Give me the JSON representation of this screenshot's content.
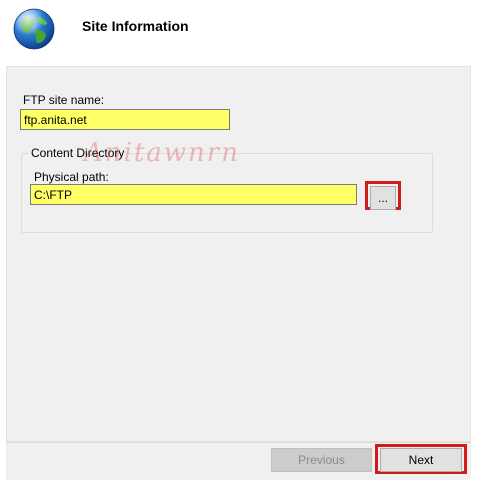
{
  "header": {
    "title": "Site Information",
    "icon": "globe-icon"
  },
  "form": {
    "site_name_label": "FTP site name:",
    "site_name_value": "ftp.anita.net",
    "content_directory_legend": "Content Directory",
    "physical_path_label": "Physical path:",
    "physical_path_value": "C:\\FTP",
    "browse_label": "..."
  },
  "watermark": "Anitawnrn",
  "footer": {
    "previous_label": "Previous",
    "next_label": "Next"
  },
  "colors": {
    "input_highlight": "#ffff66",
    "annotation_red": "#d11a1a"
  }
}
